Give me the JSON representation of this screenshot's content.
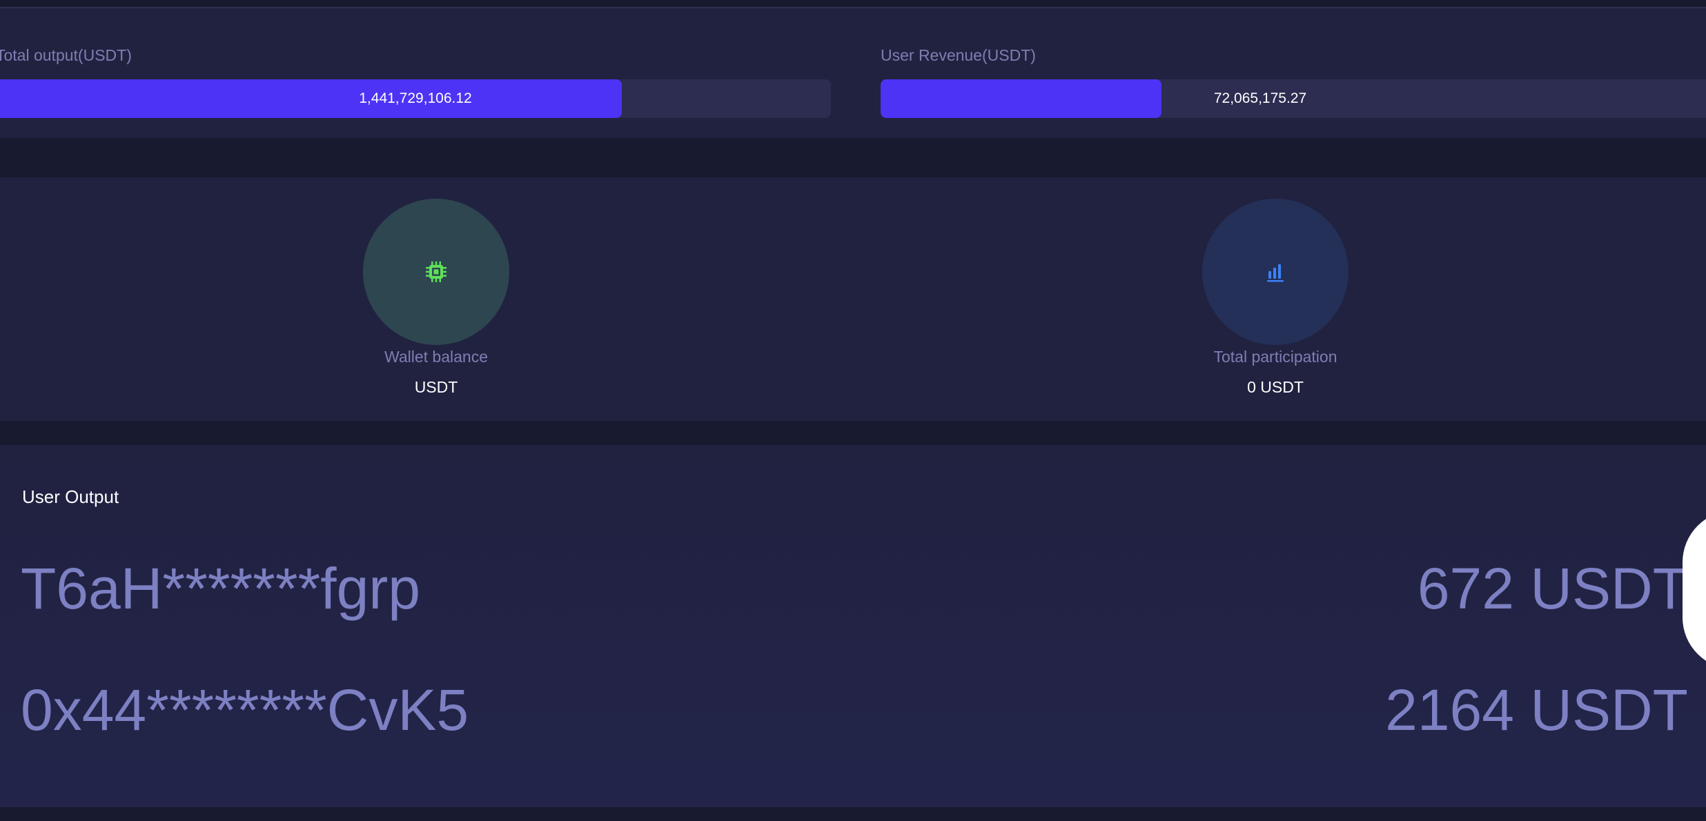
{
  "stats": {
    "total_output": {
      "label": "Total output(USDT)",
      "value": "1,441,729,106.12",
      "progress": 0.748
    },
    "user_revenue": {
      "label": "User Revenue(USDT)",
      "value": "72,065,175.27",
      "progress": 0.34
    }
  },
  "wallet": {
    "balance": {
      "label": "Wallet balance",
      "value": "USDT",
      "icon": "cpu-chip-icon",
      "icon_color": "#5fe05a"
    },
    "participation": {
      "label": "Total participation",
      "value": "0 USDT",
      "icon": "bar-chart-icon",
      "icon_color": "#3b82f6"
    }
  },
  "user_output": {
    "title": "User Output",
    "rows": [
      {
        "address": "T6aH*******fgrp",
        "amount": "672 USDT"
      },
      {
        "address": "0x44********CvK5",
        "amount": "2164 USDT"
      }
    ]
  },
  "colors": {
    "accent": "#4c33f5",
    "background": "#181a30",
    "card": "#212240",
    "muted_text": "#7d7fb3"
  }
}
